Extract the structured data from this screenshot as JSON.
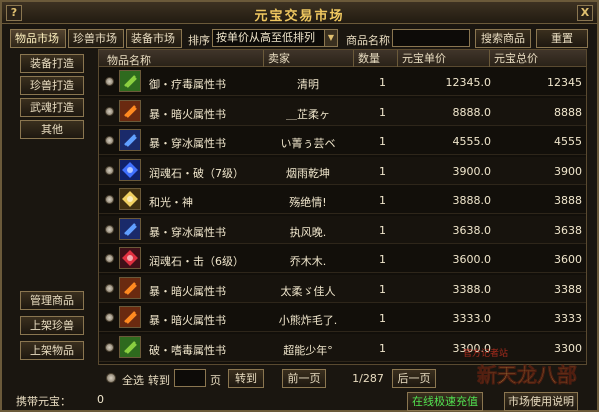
{
  "window": {
    "title": "元宝交易市场",
    "help_label": "?",
    "close_label": "X"
  },
  "tabs": [
    {
      "label": "物品市场",
      "active": true
    },
    {
      "label": "珍兽市场",
      "active": false
    },
    {
      "label": "装备市场",
      "active": false
    }
  ],
  "toolbar": {
    "sort_label": "排序",
    "sort_value": "按单价从高至低排列",
    "name_label": "商品名称",
    "name_value": "",
    "search_button": "搜索商品",
    "reset_button": "重置"
  },
  "sidebar": {
    "categories": [
      "装备打造",
      "珍兽打造",
      "武魂打造",
      "其他"
    ],
    "actions": [
      "管理商品",
      "上架珍兽",
      "上架物品"
    ]
  },
  "table": {
    "columns": [
      "物品名称",
      "卖家",
      "数量",
      "元宝单价",
      "元宝总价"
    ],
    "rows": [
      {
        "icon": "book-green-icon",
        "name": "御・疗毒属性书",
        "seller": "清明",
        "qty": "1",
        "unit": "12345.0",
        "total": "12345"
      },
      {
        "icon": "book-fire-icon",
        "name": "暴・暗火属性书",
        "seller": "＿芷柔ヶ",
        "qty": "1",
        "unit": "8888.0",
        "total": "8888"
      },
      {
        "icon": "book-ice-icon",
        "name": "暴・穿冰属性书",
        "seller": "い菁ぅ芸ベ",
        "qty": "1",
        "unit": "4555.0",
        "total": "4555"
      },
      {
        "icon": "gem-blue-icon",
        "name": "润魂石・破（7级）",
        "seller": "烟雨乾坤",
        "qty": "1",
        "unit": "3900.0",
        "total": "3900"
      },
      {
        "icon": "gem-gold-icon",
        "name": "和光・神",
        "seller": "殇绝情!",
        "qty": "1",
        "unit": "3888.0",
        "total": "3888"
      },
      {
        "icon": "book-ice-icon",
        "name": "暴・穿冰属性书",
        "seller": "执风晚.",
        "qty": "1",
        "unit": "3638.0",
        "total": "3638"
      },
      {
        "icon": "gem-red-icon",
        "name": "润魂石・击（6级）",
        "seller": "乔木木.",
        "qty": "1",
        "unit": "3600.0",
        "total": "3600"
      },
      {
        "icon": "book-fire-icon",
        "name": "暴・暗火属性书",
        "seller": "太柔ゞ佳人",
        "qty": "1",
        "unit": "3388.0",
        "total": "3388"
      },
      {
        "icon": "book-fire-icon",
        "name": "暴・暗火属性书",
        "seller": "小熊炸毛了.",
        "qty": "1",
        "unit": "3333.0",
        "total": "3333"
      },
      {
        "icon": "book-green-icon",
        "name": "破・嗜毒属性书",
        "seller": "超能少年°",
        "qty": "1",
        "unit": "3300.0",
        "total": "3300"
      }
    ]
  },
  "footer": {
    "select_all": "全选",
    "goto_label": "转到",
    "page_suffix": "页",
    "goto_button": "转到",
    "prev_button": "前一页",
    "page_indicator": "1/287",
    "next_button": "后一页"
  },
  "bottom": {
    "carry_label": "携带元宝：",
    "carry_value": "0",
    "recharge_button": "在线极速充值",
    "help_button": "市场使用说明"
  },
  "watermark": {
    "line1": "官方记者站",
    "line2": "新天龙八部"
  },
  "colors": {
    "accent": "#f0c860",
    "border": "#8a7650",
    "bg": "#1a1610",
    "recharge": "#50e050"
  }
}
